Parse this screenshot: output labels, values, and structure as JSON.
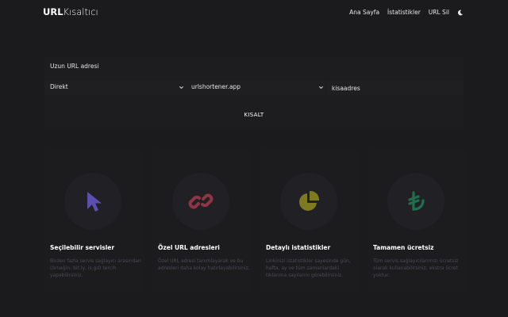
{
  "header": {
    "logo_bold": "URL",
    "logo_light": "Kısaltıcı",
    "nav": [
      "Ana Sayfa",
      "İstatistikler",
      "URL Sil"
    ],
    "theme_icon": "moon-icon"
  },
  "form": {
    "label": "Uzun URL adresi",
    "service_select": "Direkt",
    "domain_select": "urlshortener.app",
    "alias_placeholder": "kisaadres",
    "submit_label": "KISALT"
  },
  "features": [
    {
      "icon": "cursor-icon",
      "color": "#5b4fb0",
      "title": "Seçilebilir servisler",
      "description": "Birden fazla servis sağlayıcı arasından (örneğin: bit.ly, is.gd) tercih yapabilirsiniz."
    },
    {
      "icon": "link-icon",
      "color": "#8f3545",
      "title": "Özel URL adresleri",
      "description": "Özel URL adresi tanımlayarak ve bu adresleri daha kolay hatırlayabilirsiniz."
    },
    {
      "icon": "pie-chart-icon",
      "color": "#7d7a22",
      "title": "Detaylı istatistikler",
      "description": "Linkinizi istatistikler sayesinde gün, hafta, ay ve tüm zamanlardaki tıklanma sayılarını görebilirsiniz."
    },
    {
      "icon": "lira-icon",
      "color": "#1f6f4f",
      "title": "Tamamen ücretsiz",
      "description": "Tüm servis sağlayıcılarımızı ücretsiz olarak kullanabilirsiniz, ekstra ücret yoktur."
    }
  ]
}
